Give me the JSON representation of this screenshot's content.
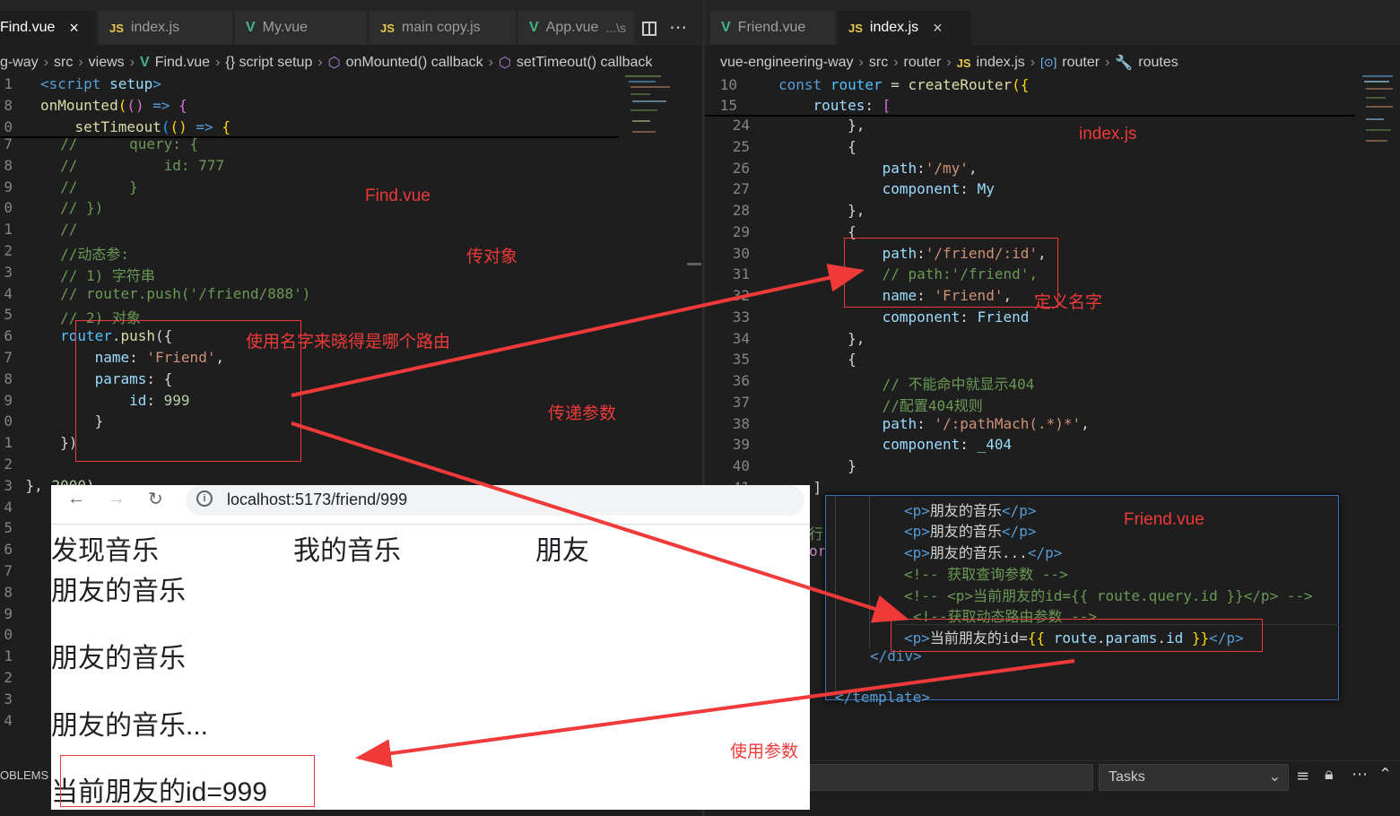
{
  "left_editor": {
    "tabs": [
      {
        "label": "Find.vue",
        "type": "vue",
        "close": "×"
      },
      {
        "label": "index.js",
        "type": "js"
      },
      {
        "label": "My.vue",
        "type": "vue"
      },
      {
        "label": "main copy.js",
        "type": "js"
      },
      {
        "label": "App.vue",
        "type": "vue",
        "hint": "...\\s"
      }
    ],
    "breadcrumb": [
      "g-way",
      "src",
      "views",
      "Find.vue",
      "{} script setup",
      "onMounted() callback",
      "setTimeout() callback"
    ],
    "sticky_lines": [
      {
        "ln": "1",
        "code": "<script setup>"
      },
      {
        "ln": "8",
        "code": "onMounted(() => {"
      },
      {
        "ln": "0",
        "code": "    setTimeout(() => {"
      }
    ],
    "line_numbers": [
      "7",
      "8",
      "9",
      "0",
      "1",
      "2",
      "3",
      "4",
      "5",
      "6",
      "7",
      "8",
      "9",
      "0",
      "1",
      "2",
      "3",
      "4",
      "5",
      "6",
      "7",
      "8",
      "9",
      "0",
      "1",
      "2",
      "3",
      "4"
    ],
    "lines": [
      "        //      query: {",
      "        //          id: 777",
      "        //      }",
      "        // })",
      "        //",
      "        //动态参:",
      "        // 1) 字符串",
      "        // router.push('/friend/888')",
      "        // 2) 对象",
      "        router.push({",
      "            name: 'Friend',",
      "            params: {",
      "                id: 999",
      "            }",
      "        })",
      "",
      "    }, 2000)"
    ],
    "problems_label": "OBLEMS"
  },
  "right_editor": {
    "tabs": [
      {
        "label": "Friend.vue",
        "type": "vue"
      },
      {
        "label": "index.js",
        "type": "js",
        "close": "×"
      }
    ],
    "breadcrumb": [
      "vue-engineering-way",
      "src",
      "router",
      "index.js",
      "router",
      "routes"
    ],
    "sticky_lines": [
      {
        "ln": "10",
        "code": "const router = createRouter({"
      },
      {
        "ln": "15",
        "code": "    routes: ["
      }
    ],
    "line_numbers": [
      "24",
      "25",
      "26",
      "27",
      "28",
      "29",
      "30",
      "31",
      "32",
      "33",
      "34",
      "35",
      "36",
      "37",
      "38",
      "39",
      "40",
      "41"
    ],
    "lines": [
      "        },",
      "        {",
      "            path:'/my',",
      "            component: My",
      "        },",
      "        {",
      "            path:'/friend/:id',",
      "            // path:'/friend',",
      "            name: 'Friend',",
      "            component: Friend",
      "        },",
      "        {",
      "            // 不能命中就显示404",
      "            //配置404规则",
      "            path: '/:pathMach(.*)*',",
      "            component: _404",
      "        }",
      "    ]"
    ],
    "fragment_behind": [
      "行",
      "ort"
    ],
    "tasks_dropdown": "Tasks"
  },
  "friend_panel": {
    "lines": [
      "<p>朋友的音乐</p>",
      "<p>朋友的音乐</p>",
      "<p>朋友的音乐...</p>",
      "<!-- 获取查询参数 -->",
      "<!-- <p>当前朋友的id={{ route.query.id }}</p> -->",
      "<!--获取动态路由参数 -->",
      "<p>当前朋友的id={{ route.params.id }}</p>",
      "</div>",
      "",
      "</template>"
    ]
  },
  "browser": {
    "url": "localhost:5173/friend/999",
    "nav_links": [
      "发现音乐",
      "我的音乐",
      "朋友"
    ],
    "paragraphs": [
      "朋友的音乐",
      "朋友的音乐",
      "朋友的音乐...",
      "当前朋友的id=999"
    ]
  },
  "annotations": {
    "find_vue": "Find.vue",
    "pass_object": "传对象",
    "use_name": "使用名字来晓得是哪个路由",
    "pass_params": "传递参数",
    "index_js": "index.js",
    "define_name": "定义名字",
    "friend_vue": "Friend.vue",
    "use_params": "使用参数"
  },
  "colors": {
    "editor_bg": "#1e1e1e",
    "annotation_red": "#f03a3a",
    "keyword": "#569cd6",
    "string": "#ce9178",
    "comment": "#6a9955"
  }
}
